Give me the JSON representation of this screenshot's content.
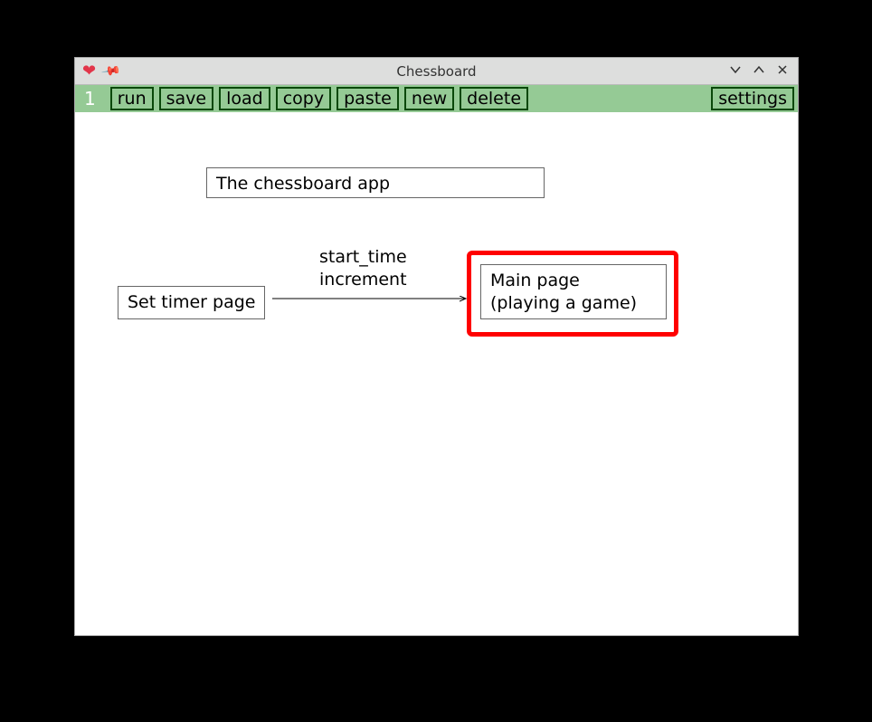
{
  "window": {
    "title": "Chessboard"
  },
  "toolbar": {
    "page_number": "1",
    "buttons": {
      "run": "run",
      "save": "save",
      "load": "load",
      "copy": "copy",
      "paste": "paste",
      "new": "new",
      "delete": "delete",
      "settings": "settings"
    }
  },
  "diagram": {
    "title_node": "The chessboard app",
    "timer_node": "Set timer page",
    "main_node_line1": "Main page",
    "main_node_line2": "(playing a game)",
    "edge_label_line1": "start_time",
    "edge_label_line2": "increment"
  }
}
